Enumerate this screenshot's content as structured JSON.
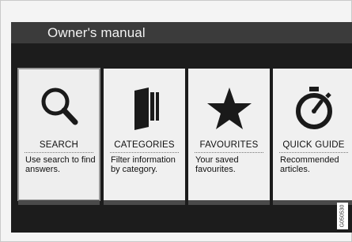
{
  "header": {
    "title": "Owner's manual"
  },
  "cards": [
    {
      "icon": "search-icon",
      "title": "SEARCH",
      "description": "Use search to find answers."
    },
    {
      "icon": "categories-icon",
      "title": "CATEGORIES",
      "description": "Filter information by category."
    },
    {
      "icon": "star-icon",
      "title": "FAVOURITES",
      "description": "Your saved favourites."
    },
    {
      "icon": "stopwatch-icon",
      "title": "QUICK GUIDE",
      "description": "Recommended articles."
    }
  ],
  "image_code": "G050530",
  "colors": {
    "screen_bg": "#1c1c1c",
    "titlebar_bg": "#3b3b3b",
    "card_bg": "#f0f0f0",
    "icon": "#1a1a1a"
  }
}
